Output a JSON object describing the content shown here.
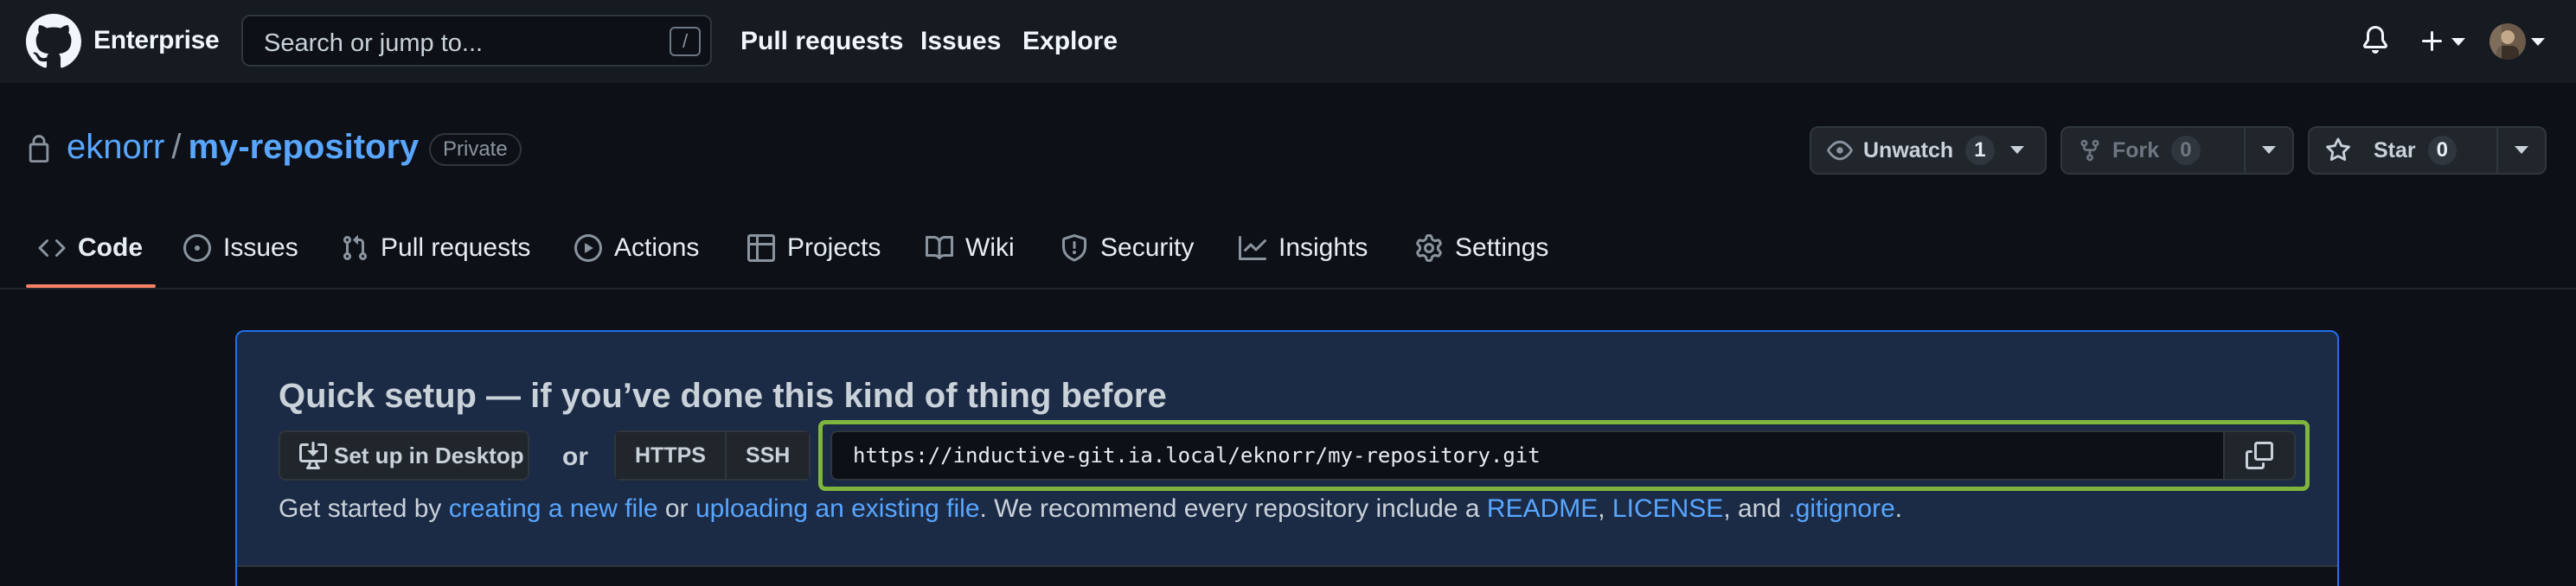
{
  "header": {
    "brand": "Enterprise",
    "search_placeholder": "Search or jump to...",
    "search_shortcut": "/",
    "nav": [
      "Pull requests",
      "Issues",
      "Explore"
    ],
    "icons": [
      "github-logo-icon",
      "bell-icon",
      "plus-icon",
      "chevron-down-icon",
      "avatar"
    ]
  },
  "repo": {
    "owner": "eknorr",
    "separator": "/",
    "name": "my-repository",
    "visibility": "Private",
    "unwatch_label": "Unwatch",
    "unwatch_count": "1",
    "fork_label": "Fork",
    "fork_count": "0",
    "star_label": "Star",
    "star_count": "0"
  },
  "tabs": [
    {
      "label": "Code",
      "icon": "code-icon",
      "active": true
    },
    {
      "label": "Issues",
      "icon": "issue-opened-icon"
    },
    {
      "label": "Pull requests",
      "icon": "git-pull-request-icon"
    },
    {
      "label": "Actions",
      "icon": "play-icon"
    },
    {
      "label": "Projects",
      "icon": "table-icon"
    },
    {
      "label": "Wiki",
      "icon": "book-icon"
    },
    {
      "label": "Security",
      "icon": "shield-icon"
    },
    {
      "label": "Insights",
      "icon": "graph-icon"
    },
    {
      "label": "Settings",
      "icon": "gear-icon"
    }
  ],
  "setup": {
    "title": "Quick setup — if you’ve done this kind of thing before",
    "desktop_button": "Set up in Desktop",
    "or": "or",
    "https": "HTTPS",
    "ssh": "SSH",
    "url": "https://inductive-git.ia.local/eknorr/my-repository.git",
    "desc_prefix": "Get started by ",
    "link_new_file": "creating a new file",
    "desc_or": " or ",
    "link_upload": "uploading an existing file",
    "desc_mid": ". We recommend every repository include a ",
    "link_readme": "README",
    "comma1": ", ",
    "link_license": "LICENSE",
    "desc_and": ", and ",
    "link_gitignore": ".gitignore",
    "desc_end": "."
  },
  "colors": {
    "background": "#0d1117",
    "header": "#161b22",
    "link": "#58a6ff",
    "active_tab_underline": "#f78166",
    "setup_box": "#1b2a45",
    "highlight_border": "#7fb53e"
  }
}
